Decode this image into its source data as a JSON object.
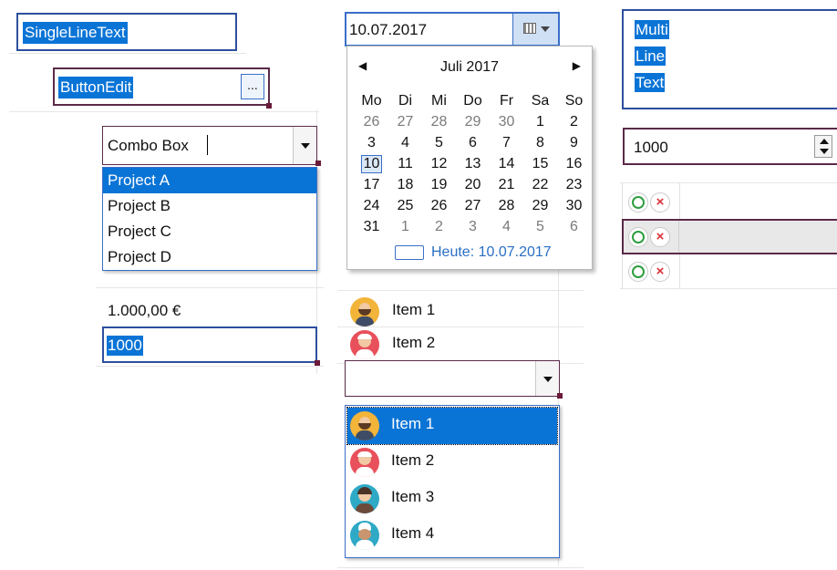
{
  "single_line": {
    "value": "SingleLineText"
  },
  "button_edit": {
    "value": "ButtonEdit",
    "button_label": "..."
  },
  "combo": {
    "value": "Combo Box",
    "items": [
      "Project A",
      "Project B",
      "Project C",
      "Project D"
    ],
    "selected_index": 0
  },
  "currency": {
    "display": "1.000,00 €",
    "edit_value": "1000"
  },
  "date": {
    "value": "10.07.2017",
    "month_label": "Juli 2017",
    "weekdays": [
      "Mo",
      "Di",
      "Mi",
      "Do",
      "Fr",
      "Sa",
      "So"
    ],
    "weeks": [
      [
        "26",
        "27",
        "28",
        "29",
        "30",
        "1",
        "2"
      ],
      [
        "3",
        "4",
        "5",
        "6",
        "7",
        "8",
        "9"
      ],
      [
        "10",
        "11",
        "12",
        "13",
        "14",
        "15",
        "16"
      ],
      [
        "17",
        "18",
        "19",
        "20",
        "21",
        "22",
        "23"
      ],
      [
        "24",
        "25",
        "26",
        "27",
        "28",
        "29",
        "30"
      ],
      [
        "31",
        "1",
        "2",
        "3",
        "4",
        "5",
        "6"
      ]
    ],
    "today_label": "Heute: 10.07.2017",
    "selected_day": "10"
  },
  "multiline": {
    "lines": [
      "Multi",
      "Line",
      "Text"
    ]
  },
  "numeric": {
    "value": "1000"
  },
  "item_list": [
    {
      "label": "Item 1",
      "avatar": "avatar-man-beard",
      "color": "#f3b43a"
    },
    {
      "label": "Item 2",
      "avatar": "avatar-woman-glasses",
      "color": "#e8505b"
    }
  ],
  "item_combo": {
    "value": "",
    "items": [
      {
        "label": "Item 1",
        "avatar": "avatar-man-beard",
        "color": "#f3b43a"
      },
      {
        "label": "Item 2",
        "avatar": "avatar-woman-glasses",
        "color": "#e8505b"
      },
      {
        "label": "Item 3",
        "avatar": "avatar-woman",
        "color": "#2ea9c6"
      },
      {
        "label": "Item 4",
        "avatar": "avatar-chef",
        "color": "#2ea9c6"
      }
    ],
    "selected_index": 0
  },
  "toggles": {
    "rows": 3,
    "highlighted_row": 1
  }
}
